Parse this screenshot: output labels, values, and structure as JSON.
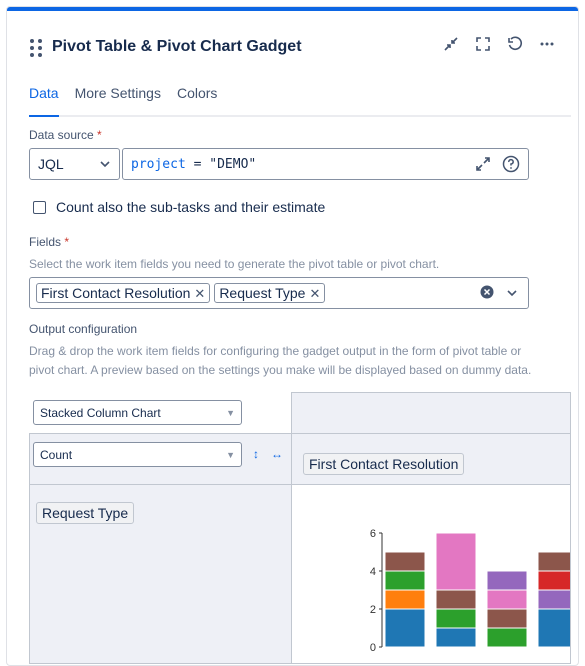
{
  "gadget": {
    "title": "Pivot Table & Pivot Chart Gadget"
  },
  "header_icons": [
    "minimize-icon",
    "fullscreen-icon",
    "refresh-icon",
    "more-icon"
  ],
  "tabs": [
    {
      "label": "Data",
      "active": true
    },
    {
      "label": "More Settings",
      "active": false
    },
    {
      "label": "Colors",
      "active": false
    }
  ],
  "data_source": {
    "label": "Data source",
    "required_mark": "*",
    "type_value": "JQL",
    "query_keyword": "project",
    "query_operator": "=",
    "query_value": "\"DEMO\""
  },
  "subtasks_checkbox": {
    "label": "Count also the sub-tasks and their estimate",
    "checked": false
  },
  "fields": {
    "label": "Fields",
    "required_mark": "*",
    "help": "Select the work item fields you need to generate the pivot table or pivot chart.",
    "selected": [
      "First Contact Resolution",
      "Request Type"
    ]
  },
  "output": {
    "label": "Output configuration",
    "help_line1": "Drag & drop the work item fields for configuring the gadget output in the form of pivot table or",
    "help_line2": "pivot chart. A preview based on the settings you make will be displayed based on dummy data.",
    "chart_type": "Stacked Column Chart",
    "measure": "Count",
    "column_field": "First Contact Resolution",
    "row_field": "Request Type"
  },
  "colors": {
    "accent": "#0c66e4",
    "series": [
      "#1f77b4",
      "#ff7f0e",
      "#2ca02c",
      "#8c564b",
      "#e377c2",
      "#9467bd",
      "#d62728"
    ]
  },
  "chart_data": {
    "type": "bar",
    "stacked": true,
    "ylim": [
      0,
      6
    ],
    "y_ticks": [
      "0",
      "2",
      "4",
      "6"
    ],
    "categories": [
      "",
      "",
      "",
      ""
    ],
    "series": [
      {
        "values": [
          2,
          1,
          0,
          2
        ]
      },
      {
        "values": [
          1,
          0,
          0,
          0
        ]
      },
      {
        "values": [
          1,
          1,
          1,
          0
        ]
      },
      {
        "values": [
          1,
          1,
          1,
          0
        ]
      },
      {
        "values": [
          0,
          3,
          1,
          0
        ]
      },
      {
        "values": [
          0,
          0,
          1,
          1
        ]
      },
      {
        "values": [
          0,
          0,
          0,
          1
        ]
      }
    ],
    "series_extra_top": [
      0,
      0,
      0,
      1
    ]
  }
}
